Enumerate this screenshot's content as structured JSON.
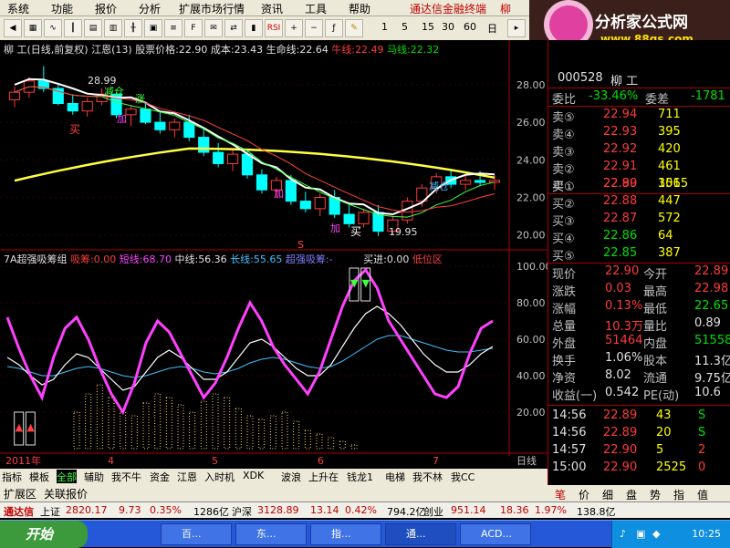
{
  "menu": {
    "items": [
      "系统",
      "功能",
      "报价",
      "分析",
      "扩展市场行情",
      "资讯",
      "工具",
      "帮助"
    ],
    "title": "通达信金融终端",
    "title_right": "柳"
  },
  "toolbar": {
    "periods": [
      "1",
      "5",
      "15",
      "30",
      "60",
      "日"
    ]
  },
  "logo": {
    "title": "分析家公式网",
    "url": "www.88gs.com"
  },
  "kline_header": {
    "prefix": "柳",
    "name": "工(日线,前复权)",
    "indicator": "江恩(13)",
    "price_label": "股票价格:",
    "price": "22.90",
    "cost_label": "成本:",
    "cost": "23.43",
    "life_label": "生命线:",
    "life": "22.64",
    "bull_label": "牛线:",
    "bull": "22.49",
    "horse_label": "马线:",
    "horse": "22.32"
  },
  "kline_annotations": {
    "high": "28.99",
    "low": "19.95",
    "sell1": "减仓",
    "buy1": "买",
    "add1": "加",
    "sell2": "减仓",
    "buy2": "买",
    "add2": "加",
    "add3": "加",
    "s_mark": "S",
    "top_mark": "涨"
  },
  "kline_axis": {
    "ticks": [
      "28.00",
      "26.00",
      "24.00",
      "22.00",
      "20.00"
    ]
  },
  "ind_header": {
    "name": "7A超强吸筹组",
    "absorb_label": "吸筹:",
    "absorb": "0.00",
    "short_label": "短线:",
    "short": "68.70",
    "mid_label": "中线:",
    "mid": "56.36",
    "long_label": "长线:",
    "long": "55.65",
    "super_label": "超强吸筹:",
    "super": "-",
    "buy_label": "买进:",
    "buy": "0.00",
    "low_label": "低位区"
  },
  "ind_axis": {
    "ticks": [
      "100.00",
      "80.00",
      "60.00",
      "40.00",
      "20.00"
    ]
  },
  "time_axis": {
    "labels": [
      "2011年",
      "4",
      "5",
      "6",
      "7"
    ],
    "period": "日线"
  },
  "quote": {
    "code": "000528",
    "name": "柳    工",
    "weibi_label": "委比",
    "weibi": "-33.46%",
    "weicha_label": "委差",
    "weicha": "-1781",
    "sells": [
      {
        "l": "卖⑤",
        "p": "22.94",
        "v": "711"
      },
      {
        "l": "卖④",
        "p": "22.93",
        "v": "395"
      },
      {
        "l": "卖③",
        "p": "22.92",
        "v": "420"
      },
      {
        "l": "卖②",
        "p": "22.91",
        "v": "461"
      },
      {
        "l": "卖①",
        "p": "22.90",
        "v": "1565"
      }
    ],
    "buys": [
      {
        "l": "买①",
        "p": "22.89",
        "v": "301"
      },
      {
        "l": "买②",
        "p": "22.88",
        "v": "447"
      },
      {
        "l": "买③",
        "p": "22.87",
        "v": "572"
      },
      {
        "l": "买④",
        "p": "22.86",
        "v": "64"
      },
      {
        "l": "买⑤",
        "p": "22.85",
        "v": "387"
      }
    ],
    "rows": [
      {
        "l1": "现价",
        "v1": "22.90",
        "l2": "今开",
        "v2": "22.89"
      },
      {
        "l1": "涨跌",
        "v1": "0.03",
        "l2": "最高",
        "v2": "22.98"
      },
      {
        "l1": "涨幅",
        "v1": "0.13%",
        "l2": "最低",
        "v2": "22.65"
      },
      {
        "l1": "总量",
        "v1": "10.3万",
        "l2": "量比",
        "v2": "0.89"
      },
      {
        "l1": "外盘",
        "v1": "51464",
        "l2": "内盘",
        "v2": "51558"
      },
      {
        "l1": "换手",
        "v1": "1.06%",
        "l2": "股本",
        "v2": "11.3亿"
      },
      {
        "l1": "净资",
        "v1": "8.02",
        "l2": "流通",
        "v2": "9.75亿"
      },
      {
        "l1": "收益(一)",
        "v1": "0.542",
        "l2": "PE(动)",
        "v2": "10.6"
      }
    ],
    "ticks": [
      {
        "t": "14:56",
        "p": "22.89",
        "v": "43",
        "s": "S"
      },
      {
        "t": "14:56",
        "p": "22.89",
        "v": "20",
        "s": "S"
      },
      {
        "t": "14:57",
        "p": "22.90",
        "v": "5",
        "s": "2"
      },
      {
        "t": "15:00",
        "p": "22.90",
        "v": "2525",
        "s": "0"
      }
    ]
  },
  "right_tabs": [
    "笔",
    "价",
    "细",
    "盘",
    "势",
    "指",
    "值"
  ],
  "tabs": [
    "指标",
    "模板",
    "全部",
    "辅助",
    "我不牛",
    "资金",
    "江恩",
    "入时机",
    "XDK",
    "波浪",
    "上升在",
    "钱龙1",
    "电梯",
    "我不林",
    "我CC"
  ],
  "subtabs": [
    "扩展区",
    "关联报价"
  ],
  "ticker": {
    "a": "通达信",
    "sh": "上证",
    "sh_v": "2820.17",
    "sh_c": "9.73",
    "sh_p": "0.35%",
    "sh_amt": "1286亿",
    "sz": "沪深",
    "sz_v": "3128.89",
    "sz_c": "13.14",
    "sz_p": "0.42%",
    "sz_amt": "794.2亿",
    "cy": "创业",
    "cy_v": "951.14",
    "cy_c": "18.36",
    "cy_p": "1.97%",
    "cy_amt": "138.8亿"
  },
  "taskbar": {
    "start": "开始",
    "buttons": [
      "百...",
      "东...",
      "指...",
      "通...",
      "ACD..."
    ],
    "clock": "10:25"
  },
  "colors": {
    "up": "#ff3b3b",
    "down": "#00ffff",
    "yellowline": "#ffff40",
    "magenta": "#ff40ff"
  },
  "chart_data": [
    {
      "type": "line",
      "title": "",
      "series": [
        {
          "name": "K",
          "ohlc": [
            [
              27.2,
              27.9,
              26.8,
              27.6
            ],
            [
              27.6,
              28.4,
              27.3,
              28.2
            ],
            [
              28.2,
              28.99,
              27.6,
              27.8
            ],
            [
              27.8,
              28.1,
              26.9,
              27.0
            ],
            [
              27.0,
              27.5,
              26.4,
              26.6
            ],
            [
              26.6,
              27.3,
              26.3,
              27.1
            ],
            [
              27.1,
              27.8,
              26.9,
              27.5
            ],
            [
              27.5,
              27.6,
              26.2,
              26.4
            ],
            [
              26.4,
              26.9,
              25.8,
              26.7
            ],
            [
              26.7,
              27.0,
              25.9,
              26.0
            ],
            [
              26.0,
              26.6,
              25.4,
              25.6
            ],
            [
              25.6,
              26.2,
              25.2,
              26.0
            ],
            [
              26.0,
              26.4,
              25.0,
              25.2
            ],
            [
              25.2,
              25.7,
              24.2,
              24.4
            ],
            [
              24.4,
              24.9,
              23.6,
              23.8
            ],
            [
              23.8,
              24.6,
              23.4,
              24.3
            ],
            [
              24.3,
              24.5,
              23.0,
              23.2
            ],
            [
              23.2,
              23.5,
              22.2,
              22.4
            ],
            [
              22.4,
              23.1,
              22.0,
              22.9
            ],
            [
              22.9,
              23.2,
              21.6,
              21.8
            ],
            [
              21.8,
              22.3,
              21.2,
              21.4
            ],
            [
              21.4,
              22.2,
              21.0,
              22.0
            ],
            [
              22.0,
              22.4,
              20.9,
              21.1
            ],
            [
              21.1,
              21.6,
              20.4,
              20.6
            ],
            [
              20.6,
              21.4,
              20.4,
              21.2
            ],
            [
              21.2,
              21.6,
              19.95,
              20.2
            ],
            [
              20.2,
              21.0,
              20.0,
              20.8
            ],
            [
              20.8,
              22.0,
              20.6,
              21.8
            ],
            [
              21.8,
              22.7,
              21.5,
              22.5
            ],
            [
              22.5,
              23.3,
              22.2,
              23.1
            ],
            [
              23.1,
              23.5,
              22.5,
              22.7
            ],
            [
              22.7,
              23.2,
              22.4,
              22.9
            ],
            [
              22.9,
              23.4,
              22.6,
              22.8
            ],
            [
              22.8,
              23.2,
              22.4,
              22.9
            ]
          ]
        }
      ],
      "ylim": [
        19.5,
        29.5
      ]
    },
    {
      "type": "line",
      "title": "",
      "series": [
        {
          "name": "短线",
          "values": [
            72,
            55,
            40,
            28,
            50,
            66,
            72,
            60,
            44,
            30,
            20,
            36,
            58,
            70,
            64,
            52,
            40,
            28,
            36,
            50,
            66,
            80,
            70,
            56,
            46,
            38,
            30,
            42,
            60,
            78,
            92,
            98,
            88,
            70,
            60,
            50,
            40,
            30,
            28,
            34,
            52,
            66,
            70
          ]
        },
        {
          "name": "中线",
          "values": [
            50,
            46,
            40,
            35,
            38,
            46,
            52,
            50,
            44,
            38,
            32,
            34,
            42,
            50,
            54,
            50,
            44,
            38,
            38,
            42,
            50,
            58,
            60,
            56,
            50,
            44,
            40,
            40,
            46,
            56,
            66,
            74,
            78,
            74,
            68,
            60,
            52,
            46,
            42,
            42,
            46,
            52,
            56
          ]
        },
        {
          "name": "长线",
          "values": [
            45,
            44,
            42,
            40,
            40,
            42,
            44,
            45,
            44,
            42,
            40,
            39,
            40,
            42,
            44,
            45,
            44,
            42,
            41,
            42,
            44,
            47,
            49,
            50,
            49,
            47,
            45,
            44,
            45,
            48,
            52,
            56,
            60,
            62,
            62,
            60,
            58,
            56,
            54,
            53,
            53,
            54,
            55
          ]
        },
        {
          "name": "吸筹",
          "values": [
            0,
            0,
            0,
            0,
            0,
            0,
            20,
            30,
            35,
            28,
            20,
            18,
            25,
            30,
            28,
            24,
            20,
            26,
            30,
            28,
            22,
            18,
            16,
            18,
            20,
            15,
            10,
            8,
            6,
            4,
            2,
            0,
            0,
            0,
            0,
            0,
            0,
            0,
            0,
            0,
            0,
            0,
            0
          ]
        }
      ],
      "ylim": [
        0,
        100
      ]
    }
  ]
}
